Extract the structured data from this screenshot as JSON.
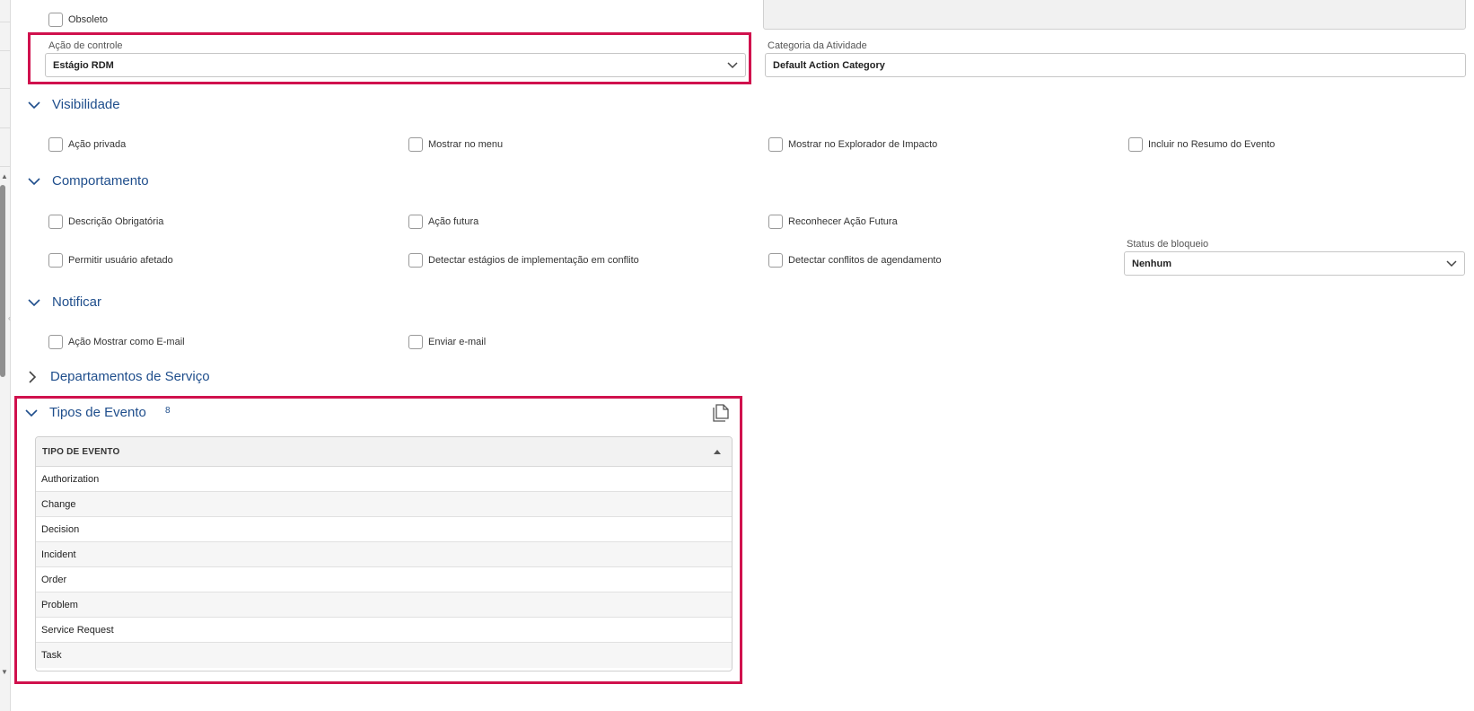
{
  "top": {
    "obsoleto_label": "Obsoleto"
  },
  "fields": {
    "acao_controle": {
      "label": "Ação de controle",
      "value": "Estágio RDM"
    },
    "categoria": {
      "label": "Categoria da Atividade",
      "value": "Default Action Category"
    },
    "status_bloqueio": {
      "label": "Status de bloqueio",
      "value": "Nenhum"
    }
  },
  "sections": {
    "visibilidade": {
      "title": "Visibilidade",
      "checks": [
        "Ação privada",
        "Mostrar no menu",
        "Mostrar no Explorador de Impacto",
        "Incluir no Resumo do Evento"
      ]
    },
    "comportamento": {
      "title": "Comportamento",
      "checks": [
        "Descrição Obrigatória",
        "Ação futura",
        "Reconhecer Ação Futura",
        "Permitir usuário afetado",
        "Detectar estágios de implementação em conflito",
        "Detectar conflitos de agendamento"
      ]
    },
    "notificar": {
      "title": "Notificar",
      "checks": [
        "Ação Mostrar como E-mail",
        "Enviar e-mail"
      ]
    },
    "departamentos": {
      "title": "Departamentos de Serviço"
    },
    "tipos": {
      "title": "Tipos de Evento",
      "count": "8",
      "column_header": "TIPO DE EVENTO",
      "rows": [
        "Authorization",
        "Change",
        "Decision",
        "Incident",
        "Order",
        "Problem",
        "Service Request",
        "Task"
      ]
    }
  },
  "colors": {
    "highlight": "#d0114d",
    "section_title": "#1f4e8c"
  },
  "icons": {
    "expand": "chevron-down-icon",
    "collapsed": "chevron-right-icon",
    "copy": "copy-icon",
    "sort": "sort-asc-icon"
  }
}
